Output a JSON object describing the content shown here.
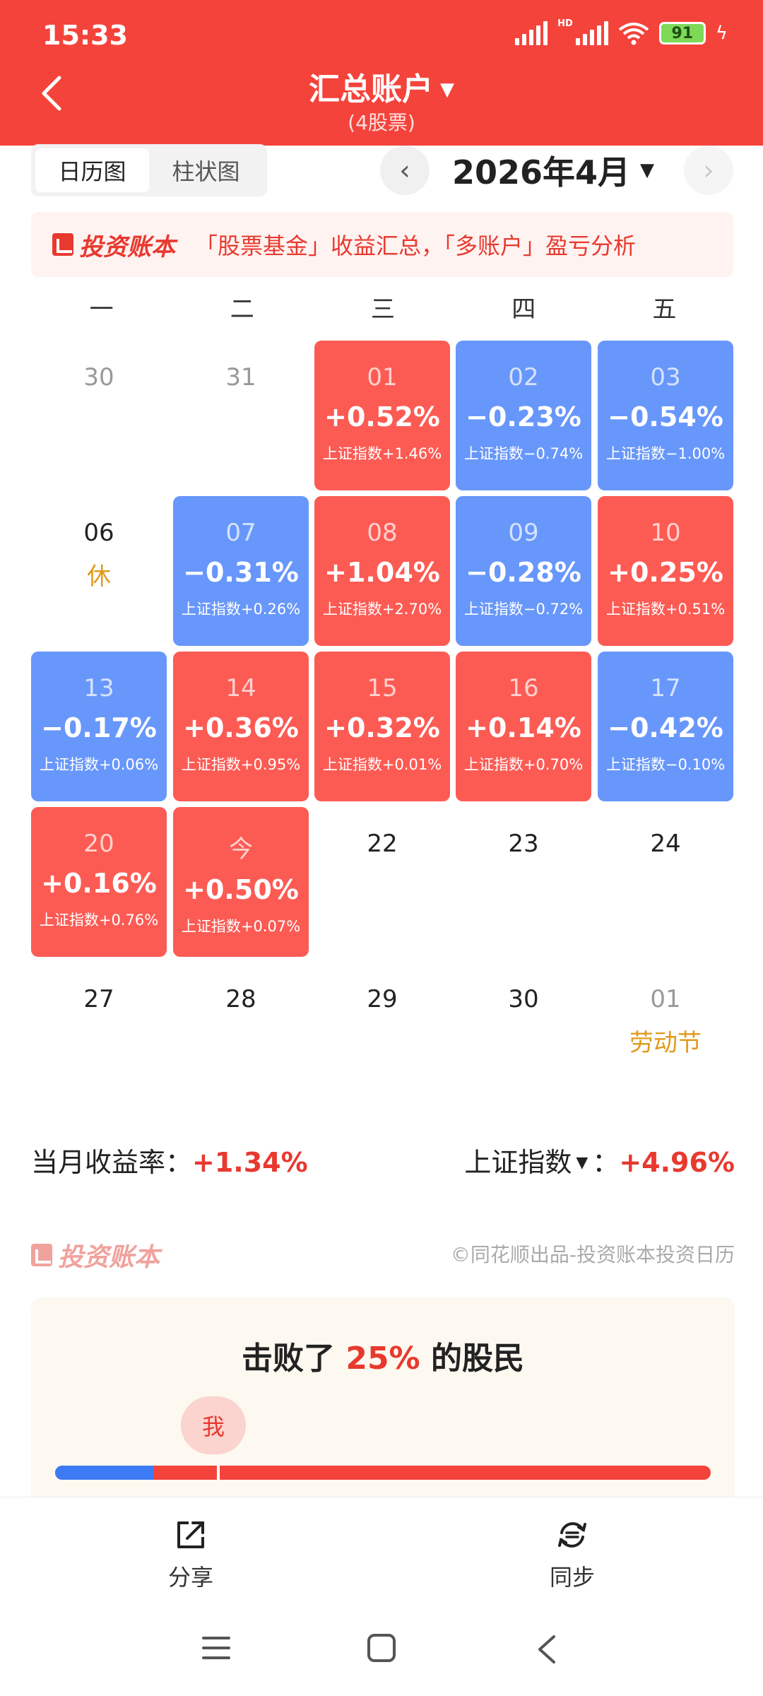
{
  "status_bar": {
    "time": "15:33",
    "hd": "HD",
    "battery": "91"
  },
  "header": {
    "title": "汇总账户",
    "subtitle": "(4股票)"
  },
  "toggle": {
    "calendar": "日历图",
    "bar": "柱状图"
  },
  "month": {
    "label": "2026年4月",
    "prev": "‹",
    "next": "›"
  },
  "banner": {
    "brand": "投资账本",
    "text": "「股票基金」收益汇总，「多账户」盈亏分析"
  },
  "weekdays": [
    "一",
    "二",
    "三",
    "四",
    "五"
  ],
  "days": [
    {
      "num": "30",
      "type": "other"
    },
    {
      "num": "31",
      "type": "other"
    },
    {
      "num": "01",
      "type": "up",
      "ret": "+0.52%",
      "idx": "上证指数+1.46%"
    },
    {
      "num": "02",
      "type": "down",
      "ret": "−0.23%",
      "idx": "上证指数−0.74%"
    },
    {
      "num": "03",
      "type": "down",
      "ret": "−0.54%",
      "idx": "上证指数−1.00%"
    },
    {
      "num": "06",
      "type": "plain",
      "note": "休"
    },
    {
      "num": "07",
      "type": "down",
      "ret": "−0.31%",
      "idx": "上证指数+0.26%"
    },
    {
      "num": "08",
      "type": "up",
      "ret": "+1.04%",
      "idx": "上证指数+2.70%"
    },
    {
      "num": "09",
      "type": "down",
      "ret": "−0.28%",
      "idx": "上证指数−0.72%"
    },
    {
      "num": "10",
      "type": "up",
      "ret": "+0.25%",
      "idx": "上证指数+0.51%"
    },
    {
      "num": "13",
      "type": "down",
      "ret": "−0.17%",
      "idx": "上证指数+0.06%"
    },
    {
      "num": "14",
      "type": "up",
      "ret": "+0.36%",
      "idx": "上证指数+0.95%"
    },
    {
      "num": "15",
      "type": "up",
      "ret": "+0.32%",
      "idx": "上证指数+0.01%"
    },
    {
      "num": "16",
      "type": "up",
      "ret": "+0.14%",
      "idx": "上证指数+0.70%"
    },
    {
      "num": "17",
      "type": "down",
      "ret": "−0.42%",
      "idx": "上证指数−0.10%"
    },
    {
      "num": "20",
      "type": "up",
      "ret": "+0.16%",
      "idx": "上证指数+0.76%"
    },
    {
      "num": "今",
      "type": "up",
      "ret": "+0.50%",
      "idx": "上证指数+0.07%"
    },
    {
      "num": "22",
      "type": "plain"
    },
    {
      "num": "23",
      "type": "plain"
    },
    {
      "num": "24",
      "type": "plain"
    },
    {
      "num": "27",
      "type": "plain"
    },
    {
      "num": "28",
      "type": "plain"
    },
    {
      "num": "29",
      "type": "plain"
    },
    {
      "num": "30",
      "type": "plain"
    },
    {
      "num": "01",
      "type": "other",
      "note": "劳动节"
    }
  ],
  "summary": {
    "month_label": "当月收益率：",
    "month_value": "+1.34%",
    "index_label": "上证指数",
    "index_sep": "：",
    "index_value": "+4.96%"
  },
  "brand_row": {
    "brand": "投资账本",
    "credit": "©同花顺出品-投资账本投资日历"
  },
  "beat": {
    "prefix": "击败了 ",
    "pct": "25%",
    "suffix": " 的股民",
    "me": "我",
    "fraction": 0.25
  },
  "bottom_tabs": {
    "share": "分享",
    "sync": "同步"
  },
  "colors": {
    "up": "#fc5b54",
    "down": "#6897fb",
    "header": "#f4433b",
    "holiday": "#e09b1c"
  }
}
